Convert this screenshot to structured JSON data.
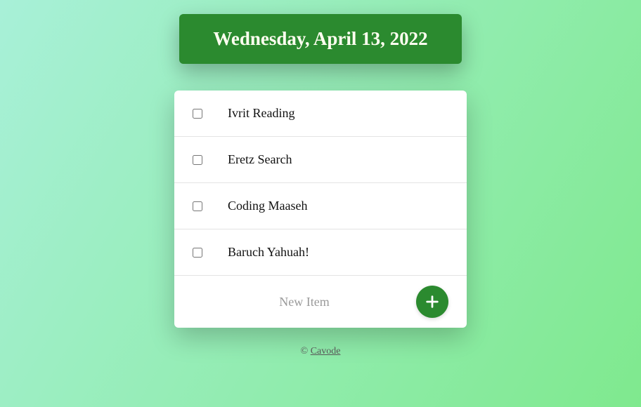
{
  "header": {
    "date": "Wednesday, April 13, 2022"
  },
  "todos": [
    {
      "label": "Ivrit Reading",
      "checked": false
    },
    {
      "label": "Eretz Search",
      "checked": false
    },
    {
      "label": "Coding Maaseh",
      "checked": false
    },
    {
      "label": "Baruch Yahuah!",
      "checked": false
    }
  ],
  "newItem": {
    "placeholder": "New Item",
    "value": ""
  },
  "footer": {
    "copyright": "© ",
    "link_text": "Cavode"
  },
  "colors": {
    "accent": "#2b8a2f",
    "bg_start": "#a8f0d8",
    "bg_end": "#7fe98e"
  }
}
